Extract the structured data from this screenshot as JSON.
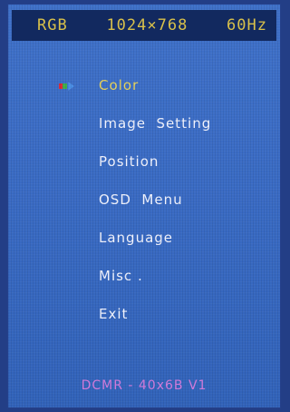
{
  "status_bar": {
    "signal": "RGB",
    "resolution": "1024×768",
    "refresh_rate": "60Hz"
  },
  "menu": {
    "selected_index": 0,
    "items": [
      {
        "label": "Color"
      },
      {
        "label": "Image  Setting"
      },
      {
        "label": "Position"
      },
      {
        "label": "OSD  Menu"
      },
      {
        "label": "Language"
      },
      {
        "label": "Misc ."
      },
      {
        "label": "Exit"
      }
    ]
  },
  "footer": {
    "model": "DCMR - 40x6B   V1"
  },
  "colors": {
    "background": "#3a6bc4",
    "status_bar": "#12295f",
    "status_text": "#d8c04a",
    "selected_text": "#e8d35a",
    "menu_text": "#f2f4ff",
    "model_text": "#cf7ad9"
  },
  "icons": {
    "selector": "rgb-arrow-selector-icon"
  }
}
